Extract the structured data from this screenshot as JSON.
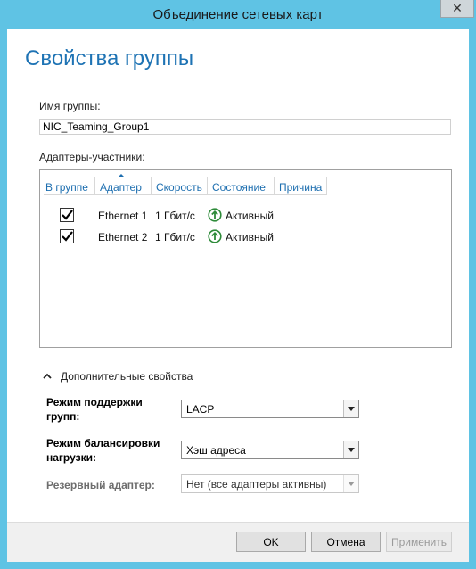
{
  "window": {
    "title": "Объединение сетевых карт",
    "close_glyph": "✕"
  },
  "heading": "Свойства группы",
  "group_name": {
    "label": "Имя группы:",
    "value": "NIC_Teaming_Group1"
  },
  "members": {
    "label": "Адаптеры-участники:",
    "columns": [
      "В группе",
      "Адаптер",
      "Скорость",
      "Состояние",
      "Причина"
    ],
    "rows": [
      {
        "checked": true,
        "adapter": "Ethernet 1",
        "speed": "1 Гбит/с",
        "status": "Активный"
      },
      {
        "checked": true,
        "adapter": "Ethernet 2",
        "speed": "1 Гбит/с",
        "status": "Активный"
      }
    ]
  },
  "advanced": {
    "toggle_label": "Дополнительные свойства",
    "teaming_mode": {
      "label_line1": "Режим поддержки",
      "label_line2": "групп:",
      "value": "LACP"
    },
    "load_balancing": {
      "label_line1": "Режим балансировки",
      "label_line2": "нагрузки:",
      "value": "Хэш адреса"
    },
    "standby": {
      "label": "Резервный адаптер:",
      "value": "Нет (все адаптеры активны)"
    }
  },
  "buttons": {
    "ok": "OK",
    "cancel": "Отмена",
    "apply": "Применить"
  },
  "colors": {
    "titlebar": "#5fc3e4",
    "heading": "#1e73b4",
    "column_header": "#1e6fb0",
    "status_ok": "#2e8b3a"
  }
}
